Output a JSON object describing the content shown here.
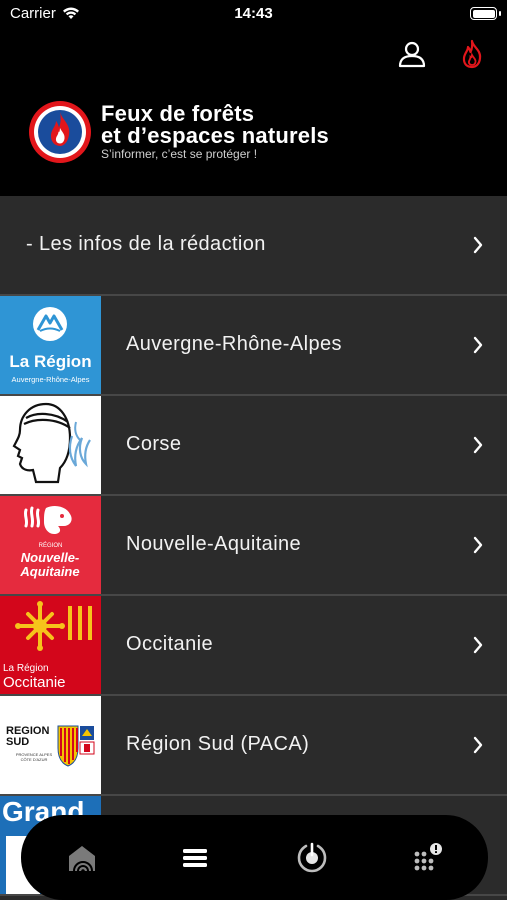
{
  "status_bar": {
    "carrier": "Carrier",
    "time": "14:43"
  },
  "header": {
    "title_line1": "Feux de forêts",
    "title_line2": "et d’espaces naturels",
    "subtitle": "S’informer, c’est se protéger !",
    "icons": {
      "profile": "user-icon",
      "fire": "flame-icon",
      "logo": "flame-shield-logo"
    },
    "accent_color": "#e2161b"
  },
  "list": {
    "items": [
      {
        "label": "- Les infos de la rédaction",
        "thumb": ""
      },
      {
        "label": "Auvergne-Rhône-Alpes",
        "thumb": "la-region-aura-logo",
        "thumb_text": "La Région",
        "thumb_sub": "Auvergne-Rhône-Alpes",
        "thumb_color": "#2f95d5"
      },
      {
        "label": "Corse",
        "thumb": "corse-head-logo",
        "thumb_color": "#ffffff"
      },
      {
        "label": "Nouvelle-Aquitaine",
        "thumb": "nouvelle-aquitaine-logo",
        "thumb_text_small": "RÉGION",
        "thumb_text": "Nouvelle-Aquitaine",
        "thumb_color": "#e52b3e"
      },
      {
        "label": "Occitanie",
        "thumb": "occitanie-cross-logo",
        "thumb_text_small": "La Région",
        "thumb_text": "Occitanie",
        "thumb_color": "#d3061b"
      },
      {
        "label": "Région Sud (PACA)",
        "thumb": "region-sud-logo",
        "thumb_text": "REGION SUD",
        "thumb_sub": "PROVENCE ALPES CÔTE D'AZUR",
        "thumb_color": "#ffffff"
      },
      {
        "label": "",
        "thumb": "grand-est-logo",
        "thumb_text": "Grand",
        "thumb_color": "#1d6fb8"
      }
    ]
  },
  "tabbar": {
    "tabs": [
      {
        "name": "home",
        "icon": "home-signal-icon"
      },
      {
        "name": "menu",
        "icon": "menu-bars-icon"
      },
      {
        "name": "location",
        "icon": "location-target-icon"
      },
      {
        "name": "more",
        "icon": "grid-dots-alert-icon"
      }
    ]
  }
}
